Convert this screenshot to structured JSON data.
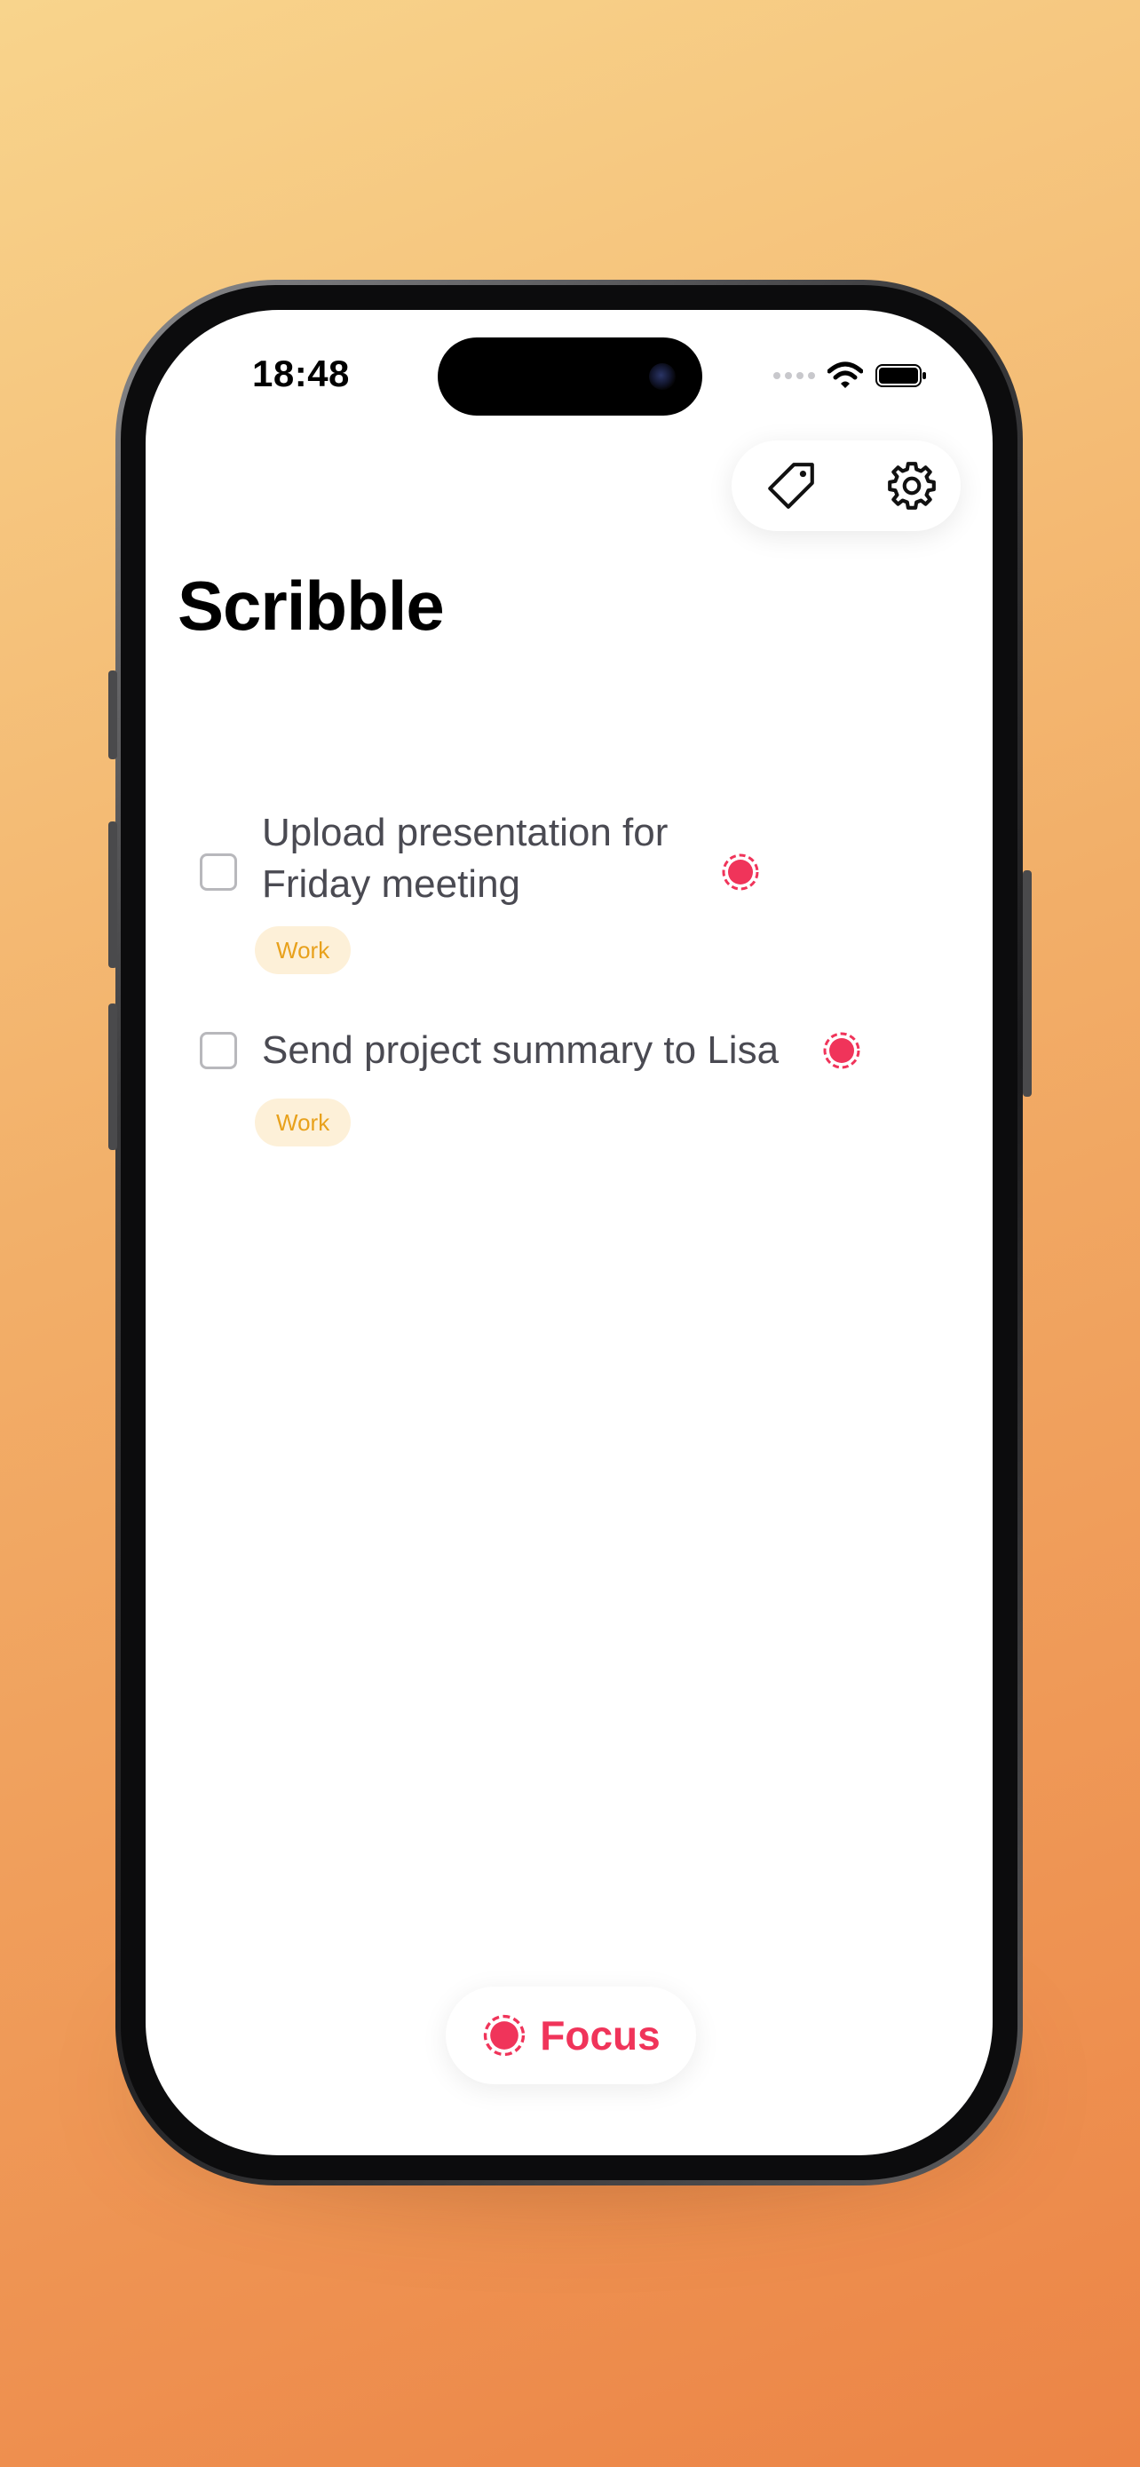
{
  "status_bar": {
    "time": "18:48"
  },
  "app": {
    "title": "Scribble"
  },
  "toolbar": {
    "tag_icon": "tag-icon",
    "settings_icon": "gear-icon"
  },
  "tasks": [
    {
      "line1": "Upload presentation for",
      "line2": "Friday meeting",
      "tag": "Work",
      "checked": false
    },
    {
      "line1": "Send project summary to Lisa",
      "tag": "Work",
      "checked": false
    }
  ],
  "focus_button": {
    "label": "Focus",
    "icon": "focus-target-icon"
  },
  "colors": {
    "accent": "#f0345a",
    "tag_bg": "#fdf0d8",
    "tag_text": "#e8a11c",
    "task_text": "#4a4a52"
  }
}
